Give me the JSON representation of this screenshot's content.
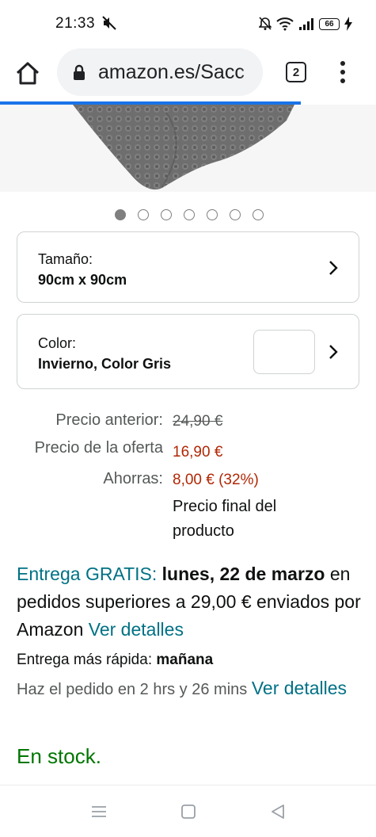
{
  "status_bar": {
    "time": "21:33",
    "battery": "66",
    "icons": [
      "mute-icon",
      "bell-off-icon",
      "wifi-icon",
      "signal-icon",
      "battery-icon",
      "charging-icon"
    ]
  },
  "browser": {
    "url": "amazon.es/Sacc",
    "tab_count": "2",
    "load_progress": 0.8,
    "accent_color": "#1a73e8"
  },
  "carousel": {
    "total": 7,
    "active_index": 0
  },
  "size_option": {
    "label": "Tamaño:",
    "value": "90cm x 90cm"
  },
  "color_option": {
    "label": "Color:",
    "value": "Invierno, Color Gris"
  },
  "pricing": {
    "previous_label": "Precio anterior:",
    "previous_value": "24,90 €",
    "offer_label": "Precio de la oferta",
    "offer_value": "16,90 €",
    "savings_label": "Ahorras:",
    "savings_value": "8,00 € (32%)",
    "final_note": "Precio final del producto"
  },
  "delivery": {
    "free_label": "Entrega GRATIS:",
    "date": "lunes, 22 de marzo",
    "condition": "en pedidos superiores a 29,00 € enviados por Amazon",
    "details_link": "Ver detalles"
  },
  "fast_delivery": {
    "label": "Entrega más rápida:",
    "when": "mañana",
    "order_text": "Haz el pedido en 2 hrs y 26 mins",
    "details_link": "Ver detalles"
  },
  "stock": "En stock.",
  "colors": {
    "price_red": "#b12704",
    "link_teal": "#007185",
    "stock_green": "#007600"
  }
}
